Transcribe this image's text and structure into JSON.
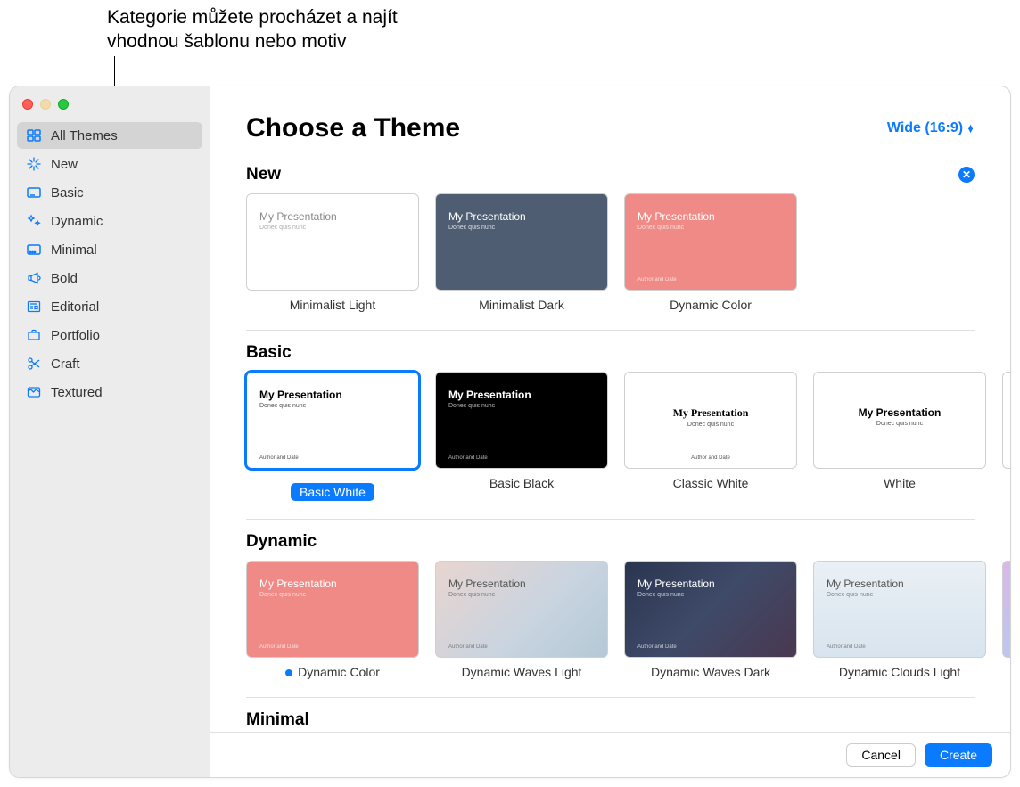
{
  "annotation": "Kategorie můžete procházet a najít vhodnou šablonu nebo motiv",
  "sidebar": {
    "items": [
      {
        "label": "All Themes",
        "icon": "grid"
      },
      {
        "label": "New",
        "icon": "sparkle"
      },
      {
        "label": "Basic",
        "icon": "rectangle"
      },
      {
        "label": "Dynamic",
        "icon": "stars"
      },
      {
        "label": "Minimal",
        "icon": "dots"
      },
      {
        "label": "Bold",
        "icon": "megaphone"
      },
      {
        "label": "Editorial",
        "icon": "newspaper"
      },
      {
        "label": "Portfolio",
        "icon": "briefcase"
      },
      {
        "label": "Craft",
        "icon": "scissors"
      },
      {
        "label": "Textured",
        "icon": "texture"
      }
    ]
  },
  "header": {
    "title": "Choose a Theme",
    "aspect": "Wide (16:9)"
  },
  "thumb_strings": {
    "title": "My Presentation",
    "subtitle": "Donec quis nunc",
    "author": "Author and Date"
  },
  "sections": {
    "new": {
      "title": "New",
      "themes": [
        {
          "name": "Minimalist Light"
        },
        {
          "name": "Minimalist Dark"
        },
        {
          "name": "Dynamic Color"
        }
      ]
    },
    "basic": {
      "title": "Basic",
      "selected": "Basic White",
      "themes": [
        {
          "name": "Basic White"
        },
        {
          "name": "Basic Black"
        },
        {
          "name": "Classic White"
        },
        {
          "name": "White"
        }
      ]
    },
    "dynamic": {
      "title": "Dynamic",
      "themes": [
        {
          "name": "Dynamic Color"
        },
        {
          "name": "Dynamic Waves Light"
        },
        {
          "name": "Dynamic Waves Dark"
        },
        {
          "name": "Dynamic Clouds Light"
        }
      ]
    },
    "minimal": {
      "title": "Minimal"
    }
  },
  "footer": {
    "cancel": "Cancel",
    "create": "Create"
  }
}
